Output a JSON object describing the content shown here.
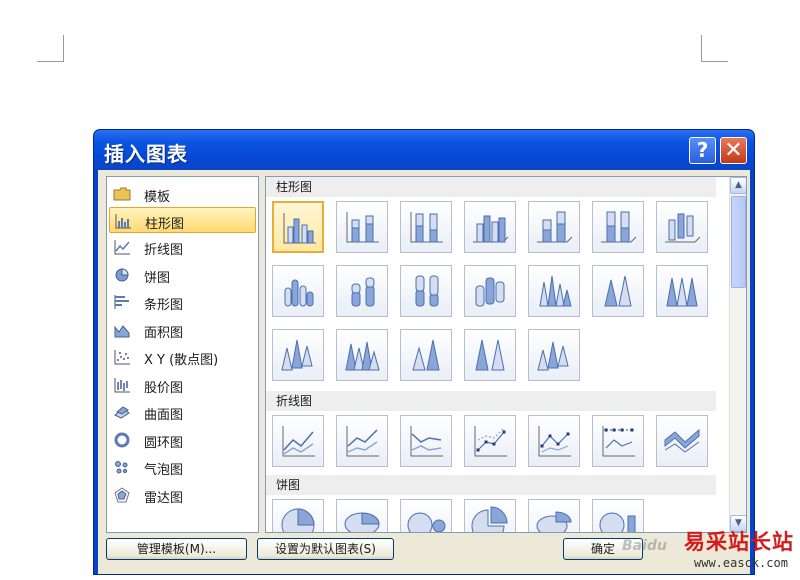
{
  "dialog": {
    "title": "插入图表",
    "help_glyph": "?",
    "close_glyph": "✕"
  },
  "categories": [
    {
      "label": "模板",
      "icon": "folder-icon"
    },
    {
      "label": "柱形图",
      "icon": "column-chart-icon",
      "selected": true
    },
    {
      "label": "折线图",
      "icon": "line-chart-icon"
    },
    {
      "label": "饼图",
      "icon": "pie-chart-icon"
    },
    {
      "label": "条形图",
      "icon": "bar-chart-icon"
    },
    {
      "label": "面积图",
      "icon": "area-chart-icon"
    },
    {
      "label": "X Y (散点图)",
      "icon": "scatter-chart-icon"
    },
    {
      "label": "股价图",
      "icon": "stock-chart-icon"
    },
    {
      "label": "曲面图",
      "icon": "surface-chart-icon"
    },
    {
      "label": "圆环图",
      "icon": "doughnut-chart-icon"
    },
    {
      "label": "气泡图",
      "icon": "bubble-chart-icon"
    },
    {
      "label": "雷达图",
      "icon": "radar-chart-icon"
    }
  ],
  "gallery": {
    "sections": [
      {
        "label": "柱形图"
      },
      {
        "label": "折线图"
      },
      {
        "label": "饼图"
      }
    ],
    "scroll_up": "▲",
    "scroll_down": "▼"
  },
  "buttons": {
    "manage_templates": "管理模板(M)...",
    "set_default": "设置为默认图表(S)",
    "ok": "确定"
  },
  "watermark": {
    "logo": "Baidu",
    "brand": "易采站长站",
    "url": "www.easck.com"
  },
  "colors": {
    "titlebar": "#0b54e3",
    "selection": "#ffd970",
    "accent_blue": "#4a6fb0"
  }
}
